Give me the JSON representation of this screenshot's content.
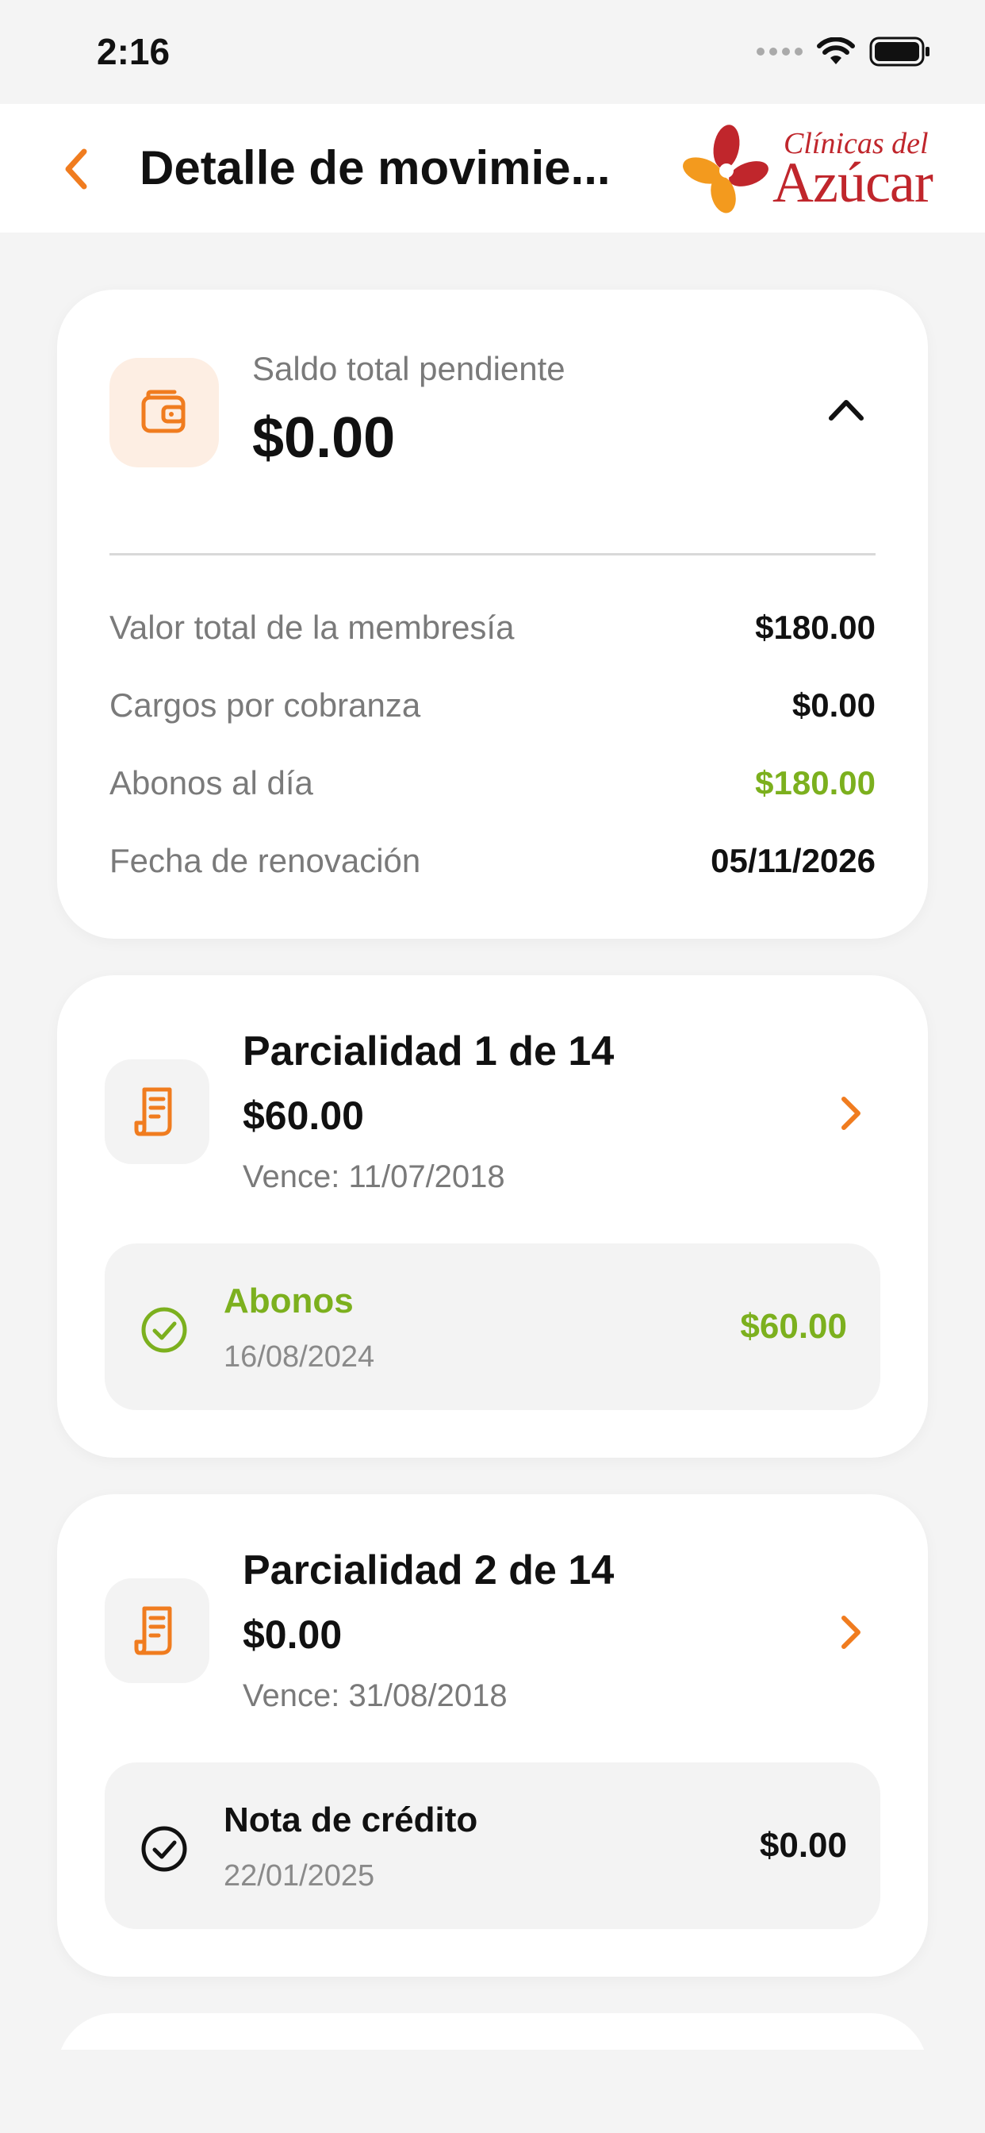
{
  "status_bar": {
    "time": "2:16"
  },
  "navbar": {
    "title": "Detalle de movimie...",
    "logo_line1": "Clínicas del",
    "logo_line2": "Azúcar"
  },
  "colors": {
    "accent": "#f07c1f",
    "green": "#7cb01e",
    "logo_red": "#c0262c"
  },
  "summary": {
    "label": "Saldo total pendiente",
    "amount": "$0.00",
    "rows": [
      {
        "label": "Valor total de la membresía",
        "value": "$180.00"
      },
      {
        "label": "Cargos por cobranza",
        "value": "$0.00"
      },
      {
        "label": "Abonos al día",
        "value": "$180.00"
      },
      {
        "label": "Fecha de renovación",
        "value": "05/11/2026"
      }
    ]
  },
  "installments": [
    {
      "title": "Parcialidad 1 de 14",
      "amount": "$60.00",
      "due": "Vence: 11/07/2018",
      "payment": {
        "type": "Abonos",
        "date": "16/08/2024",
        "amount": "$60.00"
      }
    },
    {
      "title": "Parcialidad 2 de 14",
      "amount": "$0.00",
      "due": "Vence: 31/08/2018",
      "payment": {
        "type": "Nota de crédito",
        "date": "22/01/2025",
        "amount": "$0.00"
      }
    }
  ]
}
